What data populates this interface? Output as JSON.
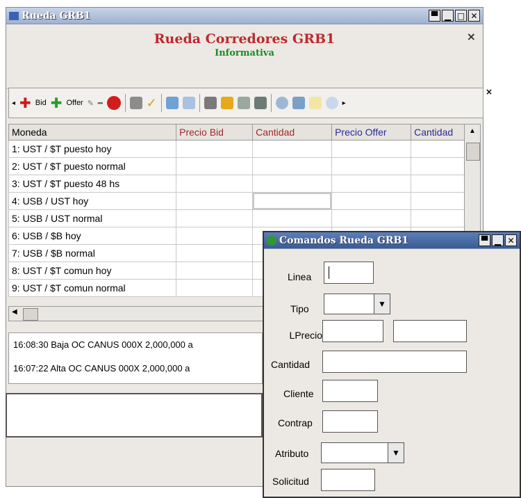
{
  "main_window": {
    "title": "Rueda GRB1",
    "header_title": "Rueda Corredores GRB1",
    "header_subtitle": "Informativa",
    "close_symbol": "×"
  },
  "toolbar": {
    "bid_label": "Bid",
    "offer_label": "Offer",
    "close_symbol": "×"
  },
  "grid": {
    "columns": [
      "Moneda",
      "Precio Bid",
      "Cantidad",
      "Precio Offer",
      "Cantidad"
    ],
    "column_colors": [
      "#000000",
      "#a0282d",
      "#a0282d",
      "#2a2a9a",
      "#2a2a9a"
    ],
    "rows": [
      "1:  UST / $T puesto hoy",
      "2:  UST / $T puesto normal",
      "3:  UST / $T puesto 48 hs",
      "4:  USB / UST hoy",
      "5:  USB / UST normal",
      "6:  USB / $B hoy",
      "7:  USB / $B normal",
      "8:  UST / $T comun hoy",
      "9:  UST / $T comun normal"
    ]
  },
  "log": [
    "16:08:30 Baja OC CANUS    000X 2,000,000 a",
    "16:07:22 Alta OC CANUS    000X 2,000,000 a"
  ],
  "dialog": {
    "title": "Comandos Rueda GRB1",
    "labels": {
      "linea": "Linea",
      "tipo": "Tipo",
      "lprecio": "LPrecio",
      "cantidad": "Cantidad",
      "cliente": "Cliente",
      "contrap": "Contrap",
      "atributo": "Atributo",
      "solicitud": "Solicitud"
    }
  }
}
